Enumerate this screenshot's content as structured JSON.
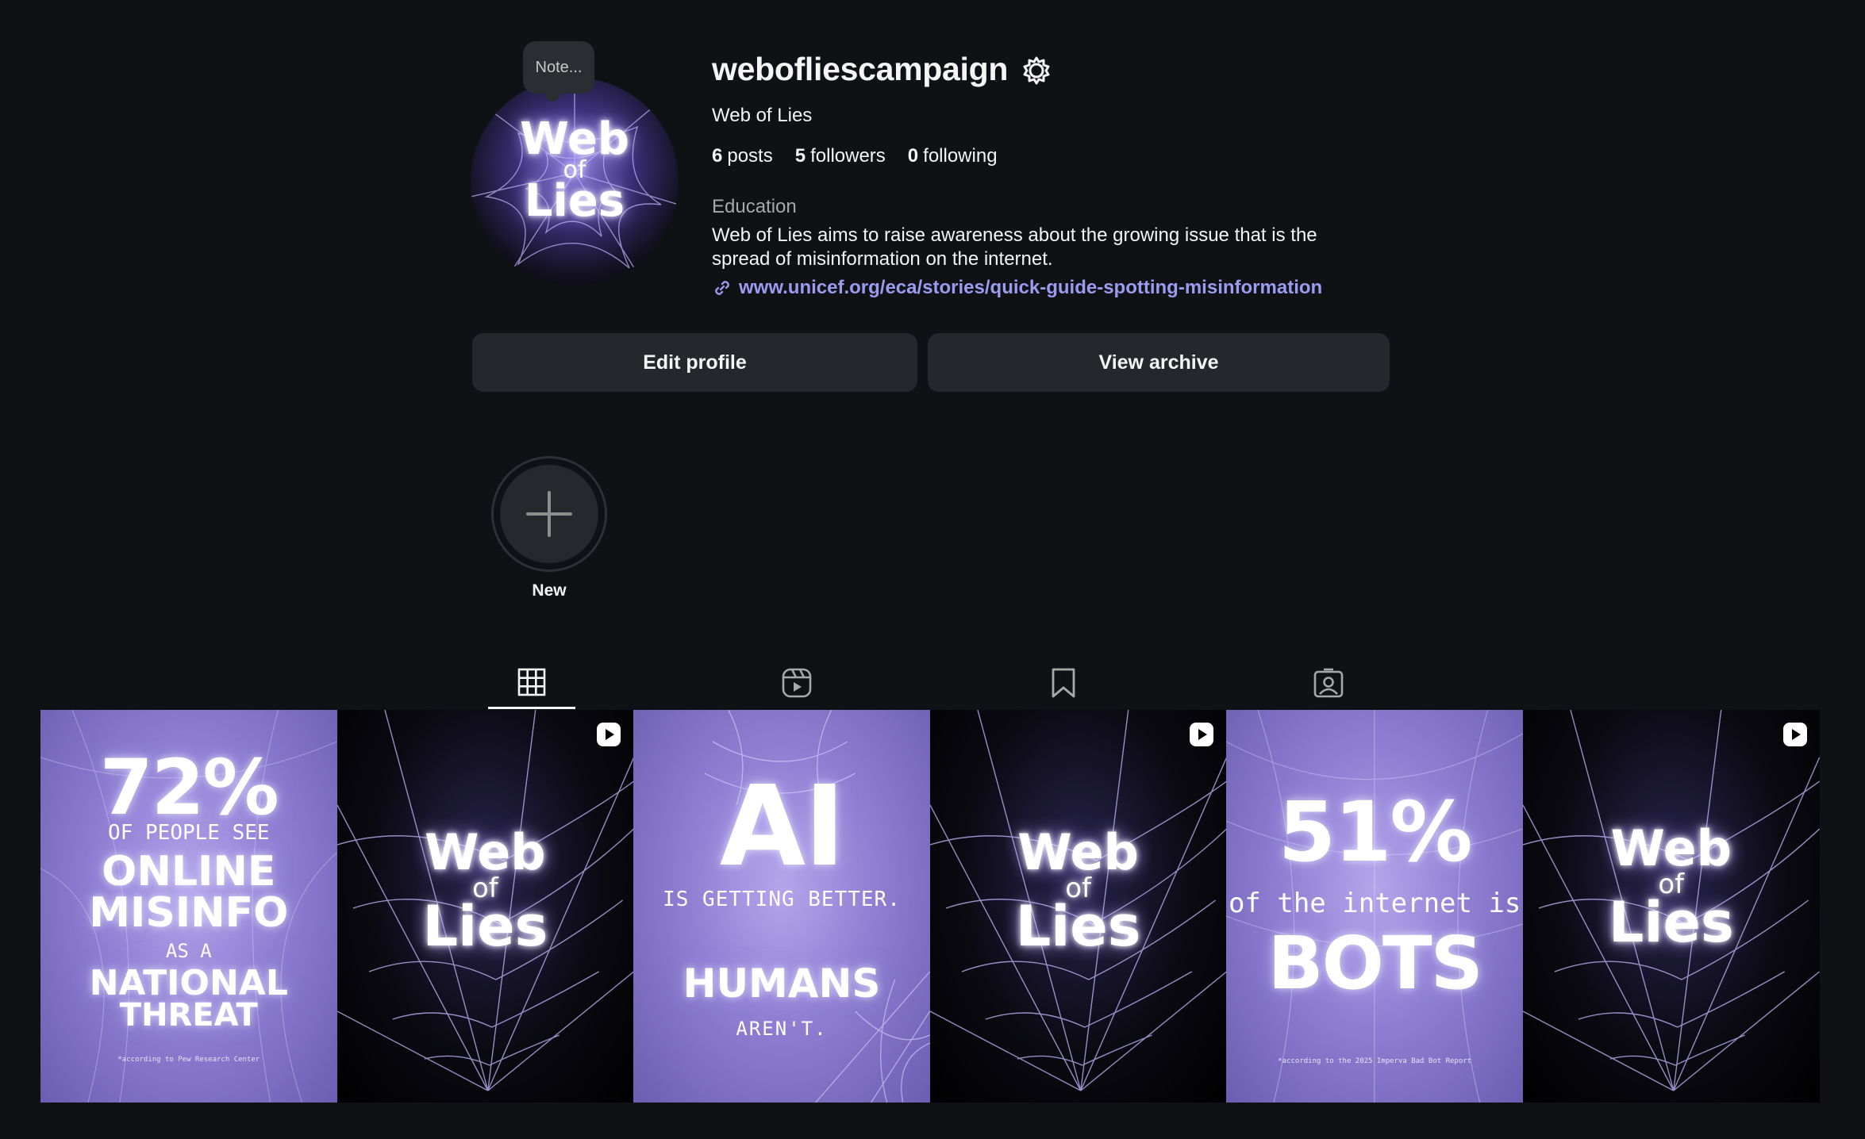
{
  "profile": {
    "note": "Note...",
    "username": "webofliescampaign",
    "full_name": "Web of Lies",
    "stats": {
      "posts_count": "6",
      "posts_label": "posts",
      "followers_count": "5",
      "followers_label": "followers",
      "following_count": "0",
      "following_label": "following"
    },
    "category": "Education",
    "bio": "Web of Lies aims to raise awareness about the growing issue that is the spread of misinformation on the internet.",
    "link": "www.unicef.org/eca/stories/quick-guide-spotting-misinformation",
    "avatar_text": {
      "line1": "Web",
      "line2": "of",
      "line3": "Lies"
    }
  },
  "buttons": {
    "edit_profile": "Edit profile",
    "view_archive": "View archive"
  },
  "highlights": {
    "new_label": "New"
  },
  "tabs": [
    {
      "name": "posts",
      "icon": "grid-icon",
      "active": true
    },
    {
      "name": "reels",
      "icon": "reels-icon",
      "active": false
    },
    {
      "name": "saved",
      "icon": "bookmark-icon",
      "active": false
    },
    {
      "name": "tagged",
      "icon": "tagged-icon",
      "active": false
    }
  ],
  "posts": [
    {
      "type": "image",
      "big": "72%",
      "l1": "OF PEOPLE SEE",
      "l2": "ONLINE",
      "l3": "MISINFO",
      "l4": "AS A",
      "l5": "NATIONAL",
      "l6": "THREAT",
      "footnote": "*according to Pew Research Center"
    },
    {
      "type": "reel",
      "logo": [
        "Web",
        "of",
        "Lies"
      ]
    },
    {
      "type": "image",
      "big": "AI",
      "l1": "IS GETTING BETTER.",
      "l2": "HUMANS",
      "l3": "AREN'T."
    },
    {
      "type": "reel",
      "logo": [
        "Web",
        "of",
        "Lies"
      ]
    },
    {
      "type": "image",
      "big": "51%",
      "l1": "of the internet is",
      "l2": "BOTS",
      "footnote": "*according to the 2025 Imperva Bad Bot Report"
    },
    {
      "type": "reel",
      "logo": [
        "Web",
        "of",
        "Lies"
      ]
    }
  ],
  "colors": {
    "background": "#0f1115",
    "button": "#25272c",
    "link": "#9b9bf0",
    "purple": "#8e7fd2"
  }
}
